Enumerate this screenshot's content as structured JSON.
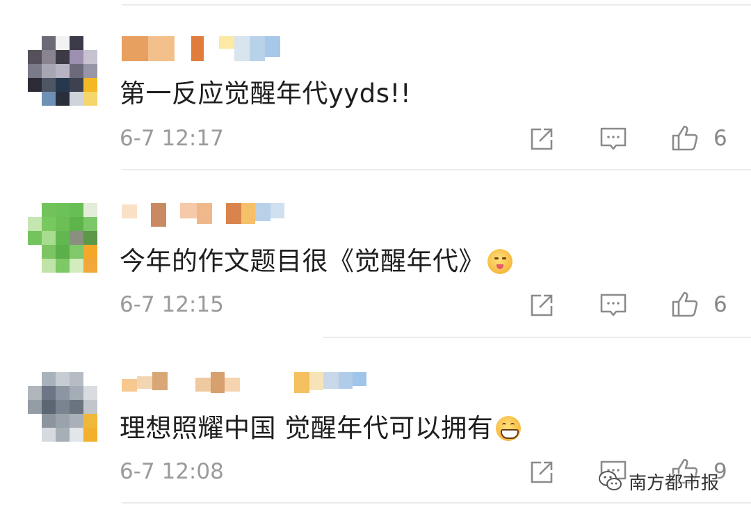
{
  "comments": [
    {
      "text": "第一反应觉醒年代yyds!!",
      "time": "6-7 12:17",
      "likes": "6",
      "emoji": ""
    },
    {
      "text": "今年的作文题目很《觉醒年代》",
      "time": "6-7 12:15",
      "likes": "6",
      "emoji": "drooling-face-emoji"
    },
    {
      "text": "理想照耀中国 觉醒年代可以拥有",
      "time": "6-7 12:08",
      "likes": "9",
      "emoji": "grinning-face-emoji"
    }
  ],
  "icons": {
    "share": "share-icon",
    "reply": "comment-icon",
    "like": "thumbs-up-icon"
  },
  "watermark": {
    "text": "南方都市报",
    "logo": "wechat-icon"
  },
  "colors": {
    "text": "#1e1e1e",
    "meta": "#9a9a9a",
    "icon": "#8a8a8a",
    "separator": "#ececec"
  }
}
